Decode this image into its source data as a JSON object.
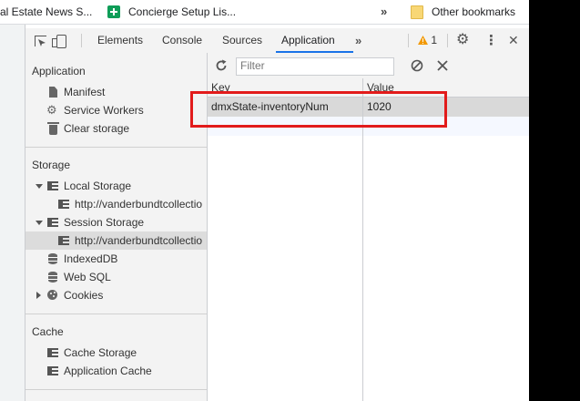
{
  "bookmarks": {
    "items": [
      {
        "label": "al Estate News S..."
      },
      {
        "label": "Concierge Setup Lis..."
      }
    ],
    "overflow": "»",
    "other": "Other bookmarks"
  },
  "devtools": {
    "tabs": [
      "Elements",
      "Console",
      "Sources",
      "Application"
    ],
    "active_tab": "Application",
    "more_tabs": "»",
    "warning_count": "1",
    "more_menu": "⋮",
    "close": "✕"
  },
  "sidebar": {
    "application": {
      "title": "Application",
      "items": [
        "Manifest",
        "Service Workers",
        "Clear storage"
      ]
    },
    "storage": {
      "title": "Storage",
      "local_storage": "Local Storage",
      "local_url": "http://vanderbundtcollectio",
      "session_storage": "Session Storage",
      "session_url": "http://vanderbundtcollectio",
      "indexeddb": "IndexedDB",
      "websql": "Web SQL",
      "cookies": "Cookies"
    },
    "cache": {
      "title": "Cache",
      "cache_storage": "Cache Storage",
      "app_cache": "Application Cache"
    }
  },
  "storage_table": {
    "filter_placeholder": "Filter",
    "columns": [
      "Key",
      "Value"
    ],
    "rows": [
      {
        "key": "dmxState-inventoryNum",
        "value": "1020"
      }
    ]
  },
  "colors": {
    "accent": "#1a73e8",
    "highlight": "#e21b1b",
    "warning": "#f29900"
  }
}
